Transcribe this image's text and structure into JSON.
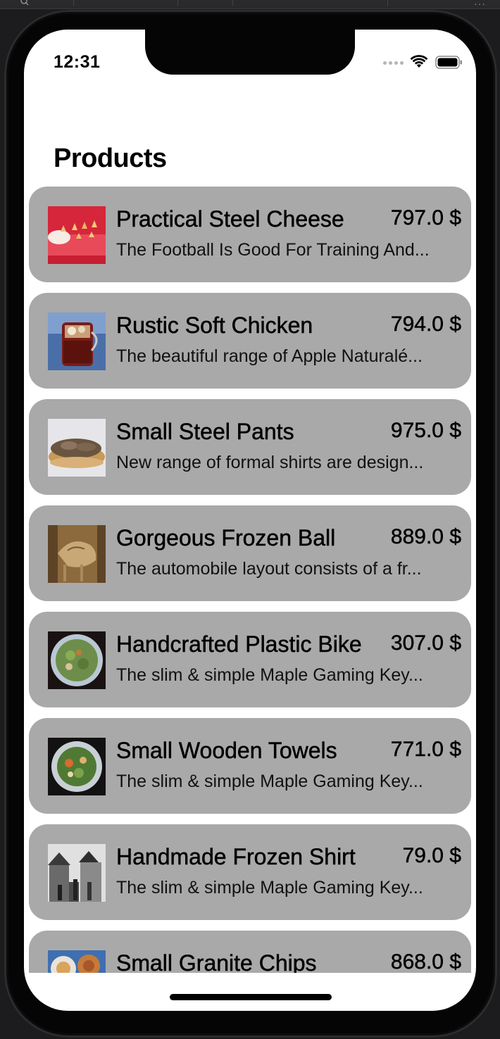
{
  "status_bar": {
    "time": "12:31"
  },
  "page": {
    "title": "Products"
  },
  "products": [
    {
      "name": "Practical Steel Cheese",
      "price": "797.0 $",
      "description": "The Football Is Good For Training And...",
      "thumbnail_icon": "food-photo-icon"
    },
    {
      "name": "Rustic Soft Chicken",
      "price": "794.0 $",
      "description": "The beautiful range of Apple Naturalé...",
      "thumbnail_icon": "drink-photo-icon"
    },
    {
      "name": "Small Steel Pants",
      "price": "975.0 $",
      "description": "New range of formal shirts are design...",
      "thumbnail_icon": "sandwich-photo-icon"
    },
    {
      "name": "Gorgeous Frozen Ball",
      "price": "889.0 $",
      "description": "The automobile layout consists of a fr...",
      "thumbnail_icon": "animal-photo-icon"
    },
    {
      "name": "Handcrafted Plastic Bike",
      "price": "307.0 $",
      "description": "The slim & simple Maple Gaming Key...",
      "thumbnail_icon": "salad-bowl-photo-icon"
    },
    {
      "name": "Small Wooden Towels",
      "price": "771.0 $",
      "description": "The slim & simple Maple Gaming Key...",
      "thumbnail_icon": "salad-plate-photo-icon"
    },
    {
      "name": "Handmade Frozen Shirt",
      "price": "79.0 $",
      "description": "The slim & simple Maple Gaming Key...",
      "thumbnail_icon": "street-photo-icon"
    },
    {
      "name": "Small Granite Chips",
      "price": "868.0 $",
      "description": "",
      "thumbnail_icon": "food-platter-photo-icon"
    }
  ],
  "colors": {
    "card_background": "#a9a9a9",
    "screen_background": "#ffffff",
    "device_frame": "#050505"
  }
}
